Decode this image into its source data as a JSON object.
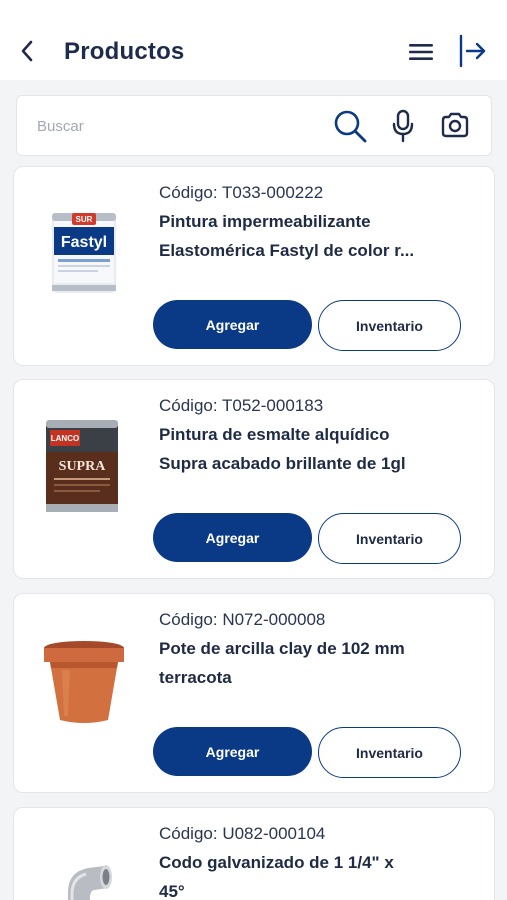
{
  "header": {
    "title": "Productos"
  },
  "search": {
    "placeholder": "Buscar"
  },
  "products": [
    {
      "code": "Código: T033-000222",
      "name": "Pintura impermeabilizante\nElastomérica Fastyl de color r...",
      "image": "paint-can-fastyl",
      "add_label": "Agregar",
      "inventory_label": "Inventario"
    },
    {
      "code": "Código: T052-000183",
      "name": "Pintura de esmalte alquídico\nSupra acabado brillante de 1gl",
      "image": "paint-can-supra",
      "add_label": "Agregar",
      "inventory_label": "Inventario"
    },
    {
      "code": "Código: N072-000008",
      "name": "Pote de arcilla clay de 102 mm\nterracota",
      "image": "clay-pot",
      "add_label": "Agregar",
      "inventory_label": "Inventario"
    },
    {
      "code": "Código: U082-000104",
      "name": "Codo galvanizado de 1 1/4\" x\n45°",
      "image": "galvanized-elbow"
    }
  ],
  "fastyl_label": {
    "brand": "SUR",
    "name": "Fastyl"
  },
  "supra_label": {
    "brand": "LANCO",
    "name": "SUPRA"
  },
  "colors": {
    "primary": "#0a3a85",
    "title": "#1e2b4a",
    "background": "#f3f4f6"
  }
}
